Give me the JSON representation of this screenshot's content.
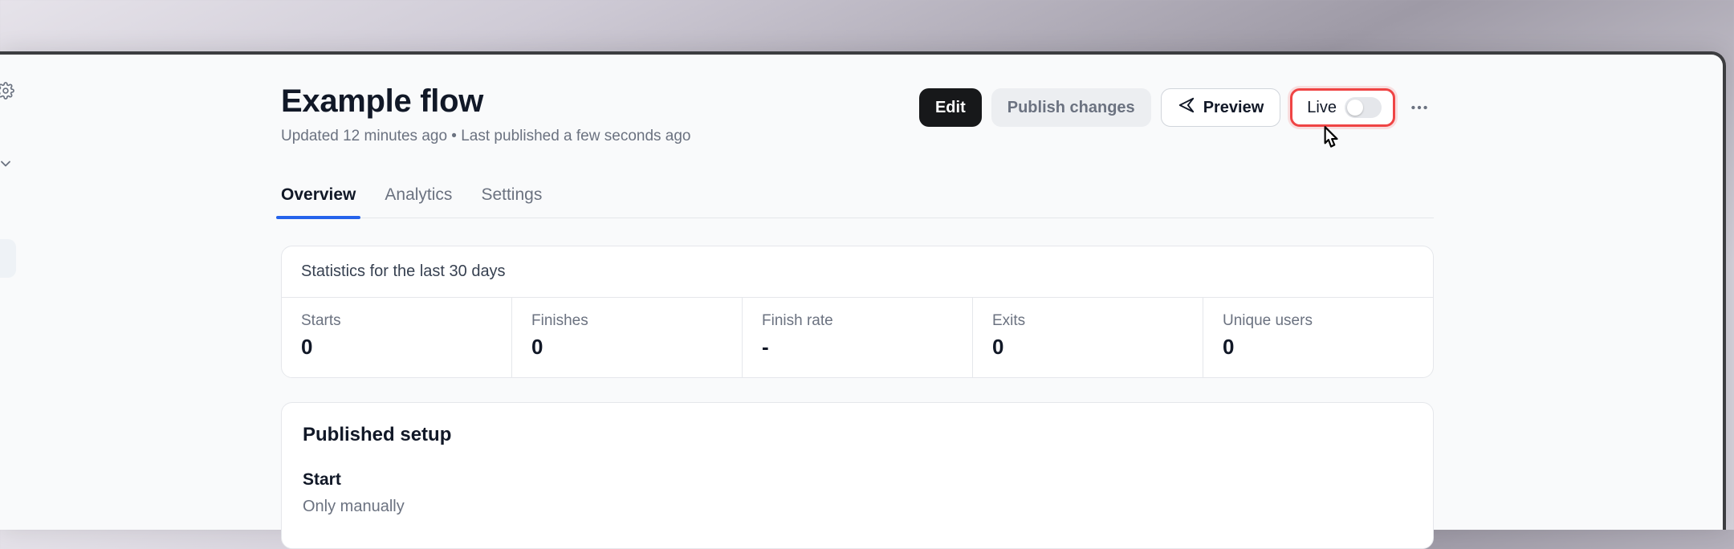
{
  "header": {
    "title": "Example flow",
    "subtitle": "Updated 12 minutes ago • Last published a few seconds ago"
  },
  "actions": {
    "edit": "Edit",
    "publish": "Publish changes",
    "preview": "Preview",
    "live": "Live"
  },
  "tabs": {
    "overview": "Overview",
    "analytics": "Analytics",
    "settings": "Settings"
  },
  "stats": {
    "title": "Statistics for the last 30 days",
    "items": [
      {
        "label": "Starts",
        "value": "0"
      },
      {
        "label": "Finishes",
        "value": "0"
      },
      {
        "label": "Finish rate",
        "value": "-"
      },
      {
        "label": "Exits",
        "value": "0"
      },
      {
        "label": "Unique users",
        "value": "0"
      }
    ]
  },
  "setup": {
    "title": "Published setup",
    "start_heading": "Start",
    "start_text": "Only manually"
  }
}
